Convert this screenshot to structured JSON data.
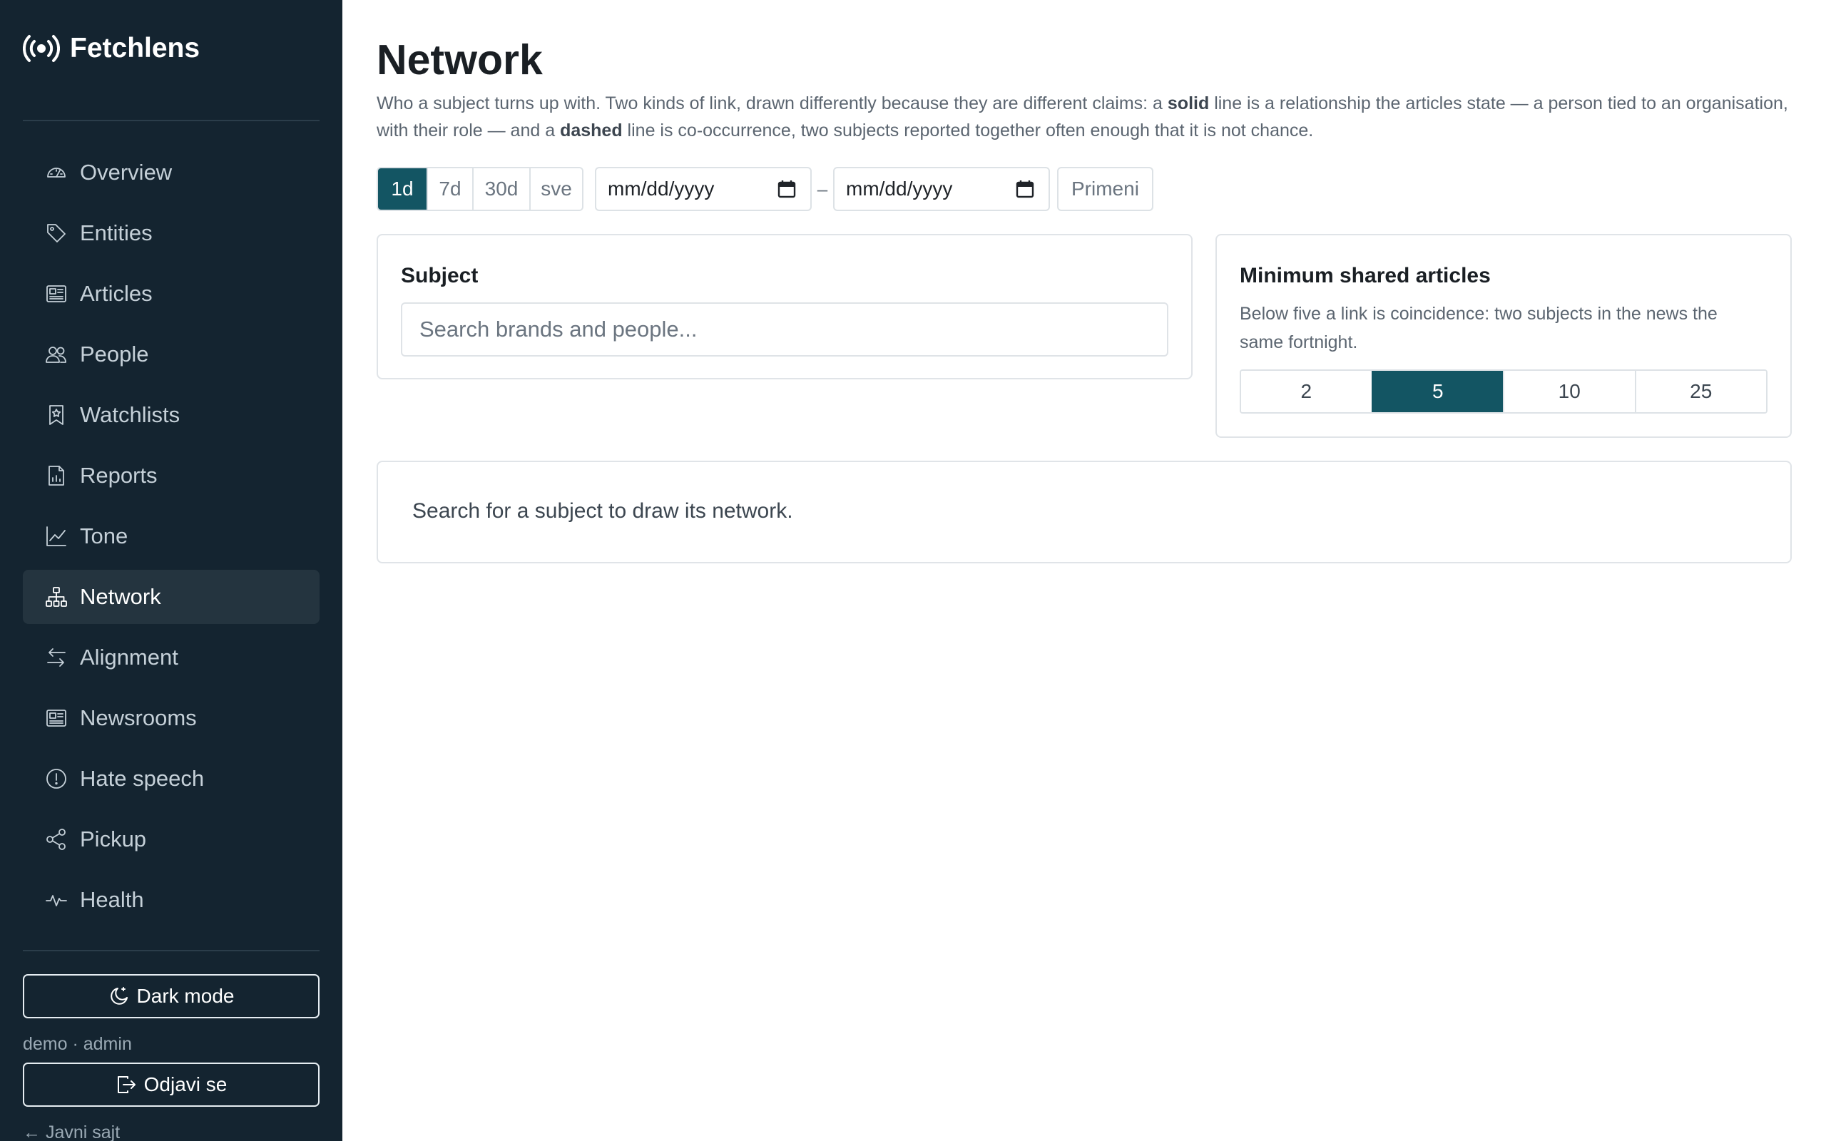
{
  "app": {
    "name": "Fetchlens"
  },
  "sidebar": {
    "items": [
      {
        "label": "Overview",
        "icon": "gauge-icon",
        "active": false
      },
      {
        "label": "Entities",
        "icon": "tag-icon",
        "active": false
      },
      {
        "label": "Articles",
        "icon": "newspaper-icon",
        "active": false
      },
      {
        "label": "People",
        "icon": "people-icon",
        "active": false
      },
      {
        "label": "Watchlists",
        "icon": "bookmark-star-icon",
        "active": false
      },
      {
        "label": "Reports",
        "icon": "file-chart-icon",
        "active": false
      },
      {
        "label": "Tone",
        "icon": "line-chart-icon",
        "active": false
      },
      {
        "label": "Network",
        "icon": "diagram-icon",
        "active": true
      },
      {
        "label": "Alignment",
        "icon": "arrows-swap-icon",
        "active": false
      },
      {
        "label": "Newsrooms",
        "icon": "newspaper-icon",
        "active": false
      },
      {
        "label": "Hate speech",
        "icon": "exclamation-circle-icon",
        "active": false
      },
      {
        "label": "Pickup",
        "icon": "share-icon",
        "active": false
      },
      {
        "label": "Health",
        "icon": "activity-icon",
        "active": false
      }
    ],
    "dark_mode_label": "Dark mode",
    "user_line": "demo · admin",
    "logout_label": "Odjavi se",
    "public_link": "← Javni sajt"
  },
  "page": {
    "title": "Network",
    "description_parts": {
      "p1": "Who a subject turns up with. Two kinds of link, drawn differently because they are different claims: a ",
      "b1": "solid",
      "p2": " line is a relationship the articles state — a person tied to an organisation, with their role — and a ",
      "b2": "dashed",
      "p3": " line is co-occurrence, two subjects reported together often enough that it is not chance."
    }
  },
  "range": {
    "options": [
      "1d",
      "7d",
      "30d",
      "sve"
    ],
    "selected": "1d",
    "from_placeholder": "mm/dd/yyyy",
    "to_placeholder": "mm/dd/yyyy",
    "separator": "–",
    "apply_label": "Primeni"
  },
  "subject_card": {
    "title": "Subject",
    "search_placeholder": "Search brands and people..."
  },
  "min_card": {
    "title": "Minimum shared articles",
    "description": "Below five a link is coincidence: two subjects in the news the same fortnight.",
    "options": [
      "2",
      "5",
      "10",
      "25"
    ],
    "selected": "5"
  },
  "empty_state": {
    "text": "Search for a subject to draw its network."
  },
  "colors": {
    "sidebar_bg": "#142430",
    "accent": "#135563",
    "active_nav_bg": "#24343f"
  }
}
